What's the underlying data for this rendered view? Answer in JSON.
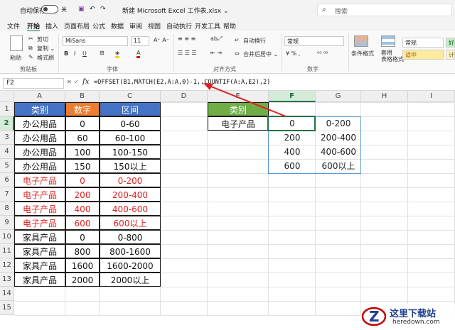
{
  "titlebar": {
    "autosave_label": "自动保存",
    "toggle_state": "关",
    "title": "新建 Microsoft Excel 工作表.xlsx ⌄",
    "search_placeholder": "搜索"
  },
  "menu": [
    "文件",
    "开始",
    "插入",
    "页面布局",
    "公式",
    "数据",
    "审阅",
    "视图",
    "自动执行",
    "开发工具",
    "帮助"
  ],
  "menu_active": "开始",
  "ribbon": {
    "paste_label": "粘贴",
    "cut_label": "剪切",
    "copy_label": "复制 ⌄",
    "format_painter_label": "格式刷",
    "clipboard_group": "剪贴板",
    "font_name": "MiSans",
    "font_size": "11",
    "font_group": "字体",
    "wrap_text": "自动换行",
    "merge_center": "合并后居中 ⌄",
    "alignment_group": "对齐方式",
    "number_format": "常规",
    "number_group": "数字",
    "conditional_format": "条件格式",
    "table_format": "套用\n表格格式",
    "style_normal": "常规",
    "style_neutral": "适中",
    "style_good_partial": "好",
    "style_bad_partial": "计"
  },
  "formula_bar": {
    "name_box": "F2",
    "fx": "fx",
    "formula": "=OFFSET(B1,MATCH(E2,A:A,0)-1,,COUNTIF(A:A,E2),2)"
  },
  "columns": [
    "A",
    "B",
    "C",
    "D",
    "E",
    "F",
    "G",
    "H",
    "I"
  ],
  "rows": [
    "1",
    "2",
    "3",
    "4",
    "5",
    "6",
    "7",
    "8",
    "9",
    "10",
    "11",
    "12",
    "13",
    "14",
    "15"
  ],
  "selected_column": "F",
  "selected_row": "2",
  "table": {
    "headers": [
      "类别",
      "数字",
      "区间"
    ],
    "rows": [
      [
        "办公用品",
        "0",
        "0-60"
      ],
      [
        "办公用品",
        "60",
        "60-100"
      ],
      [
        "办公用品",
        "100",
        "100-150"
      ],
      [
        "办公用品",
        "150",
        "150以上"
      ],
      [
        "电子产品",
        "0",
        "0-200"
      ],
      [
        "电子产品",
        "200",
        "200-400"
      ],
      [
        "电子产品",
        "400",
        "400-600"
      ],
      [
        "电子产品",
        "600",
        "600以上"
      ],
      [
        "家具产品",
        "0",
        "0-800"
      ],
      [
        "家具产品",
        "800",
        "800-1600"
      ],
      [
        "家具产品",
        "1600",
        "1600-2000"
      ],
      [
        "家具产品",
        "2000",
        "2000以上"
      ]
    ]
  },
  "lookup": {
    "header": "类别",
    "value": "电子产品",
    "results": [
      [
        "0",
        "0-200"
      ],
      [
        "200",
        "200-400"
      ],
      [
        "400",
        "400-600"
      ],
      [
        "600",
        "600以上"
      ]
    ]
  },
  "colors": {
    "header_blue": "#4472c4",
    "header_orange": "#ed7d31",
    "header_green": "#70ad47",
    "red_text": "#e02020",
    "accent": "#217346"
  },
  "watermark": {
    "name": "这里下载站",
    "url": "heredown.com"
  }
}
